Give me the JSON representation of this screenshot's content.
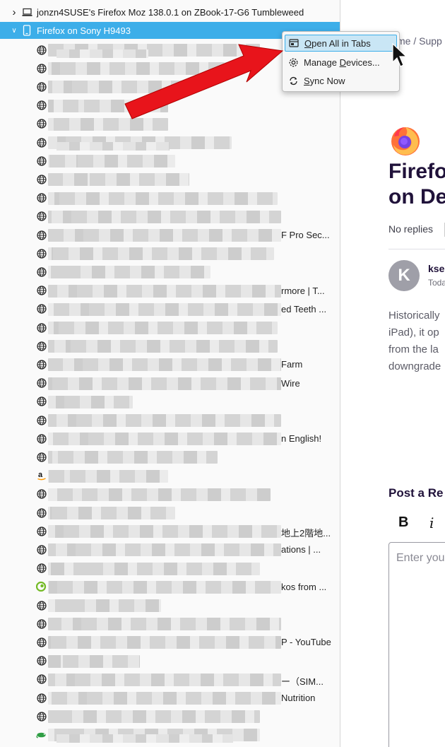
{
  "sidebar": {
    "devices": [
      {
        "name": "jonzn4SUSE's Firefox Moz 138.0.1 on ZBook-17-G6 Tumbleweed",
        "icon": "laptop-icon",
        "expanded": false,
        "selected": false
      },
      {
        "name": "Firefox on Sony H9493",
        "icon": "phone-icon",
        "expanded": true,
        "selected": true
      }
    ],
    "tabs": [
      {
        "icon": "globe",
        "tail": ""
      },
      {
        "icon": "globe",
        "tail": ""
      },
      {
        "icon": "globe",
        "tail": ""
      },
      {
        "icon": "globe",
        "tail": ""
      },
      {
        "icon": "globe",
        "tail": ""
      },
      {
        "icon": "globe",
        "tail": ""
      },
      {
        "icon": "globe",
        "tail": ""
      },
      {
        "icon": "globe",
        "tail": ""
      },
      {
        "icon": "globe",
        "tail": ""
      },
      {
        "icon": "globe",
        "tail": ""
      },
      {
        "icon": "globe",
        "tail": "F Pro Sec..."
      },
      {
        "icon": "globe",
        "tail": ""
      },
      {
        "icon": "globe",
        "tail": ""
      },
      {
        "icon": "globe",
        "tail": "rmore | T..."
      },
      {
        "icon": "globe",
        "tail": "ed Teeth ..."
      },
      {
        "icon": "globe",
        "tail": ""
      },
      {
        "icon": "globe",
        "tail": ""
      },
      {
        "icon": "globe",
        "tail": "Farm"
      },
      {
        "icon": "globe",
        "tail": "Wire"
      },
      {
        "icon": "globe",
        "tail": ""
      },
      {
        "icon": "globe",
        "tail": ""
      },
      {
        "icon": "globe",
        "tail": "n English!"
      },
      {
        "icon": "globe",
        "tail": ""
      },
      {
        "icon": "amazon",
        "tail": ""
      },
      {
        "icon": "globe",
        "tail": ""
      },
      {
        "icon": "globe",
        "tail": ""
      },
      {
        "icon": "globe",
        "tail": "地上2階地..."
      },
      {
        "icon": "globe",
        "tail": "ations | ..."
      },
      {
        "icon": "globe",
        "tail": ""
      },
      {
        "icon": "opensuse",
        "tail": "kos from ..."
      },
      {
        "icon": "globe",
        "tail": ""
      },
      {
        "icon": "globe",
        "tail": ""
      },
      {
        "icon": "globe",
        "tail": "P - YouTube"
      },
      {
        "icon": "globe",
        "tail": ""
      },
      {
        "icon": "globe",
        "tail": "ー（SIM..."
      },
      {
        "icon": "globe",
        "tail": "Nutrition"
      },
      {
        "icon": "globe",
        "tail": ""
      },
      {
        "icon": "chameleon",
        "tail": ""
      },
      {
        "icon": "globe",
        "tail": ""
      }
    ]
  },
  "context_menu": {
    "items": [
      {
        "pre": "",
        "acc": "O",
        "post": "pen All in Tabs",
        "icon": "open-tabs-icon",
        "highlighted": true
      },
      {
        "pre": "Manage ",
        "acc": "D",
        "post": "evices...",
        "icon": "gear-icon",
        "highlighted": false
      },
      {
        "pre": "",
        "acc": "S",
        "post": "ync Now",
        "icon": "sync-icon",
        "highlighted": false
      }
    ]
  },
  "page": {
    "breadcrumb": "me / Supp",
    "title_line1": "Firefo",
    "title_line2": "on De",
    "no_replies": "No replies",
    "avatar_letter": "K",
    "author": "kse",
    "date": "Toda",
    "body_lines": [
      "Historically",
      "iPad), it op",
      "from the la",
      "downgrade"
    ],
    "post_reply": "Post a Re",
    "bold_button": "B",
    "italic_button": "i",
    "editor_placeholder": "Enter you"
  },
  "colors": {
    "selection": "#3daee9",
    "menu_highlight": "#c9e6f5",
    "annotation_arrow": "#e8141b",
    "heading": "#20123a"
  }
}
